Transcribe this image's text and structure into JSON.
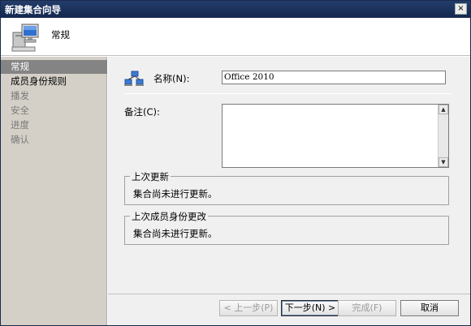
{
  "window": {
    "title": "新建集合向导",
    "close_glyph": "×"
  },
  "header": {
    "title": "常规",
    "icon": "computer-icon"
  },
  "nav": {
    "items": [
      {
        "label": "常规",
        "state": "active"
      },
      {
        "label": "成员身份规则",
        "state": "enabled"
      },
      {
        "label": "播发",
        "state": "disabled"
      },
      {
        "label": "安全",
        "state": "disabled"
      },
      {
        "label": "进度",
        "state": "disabled"
      },
      {
        "label": "确认",
        "state": "disabled"
      }
    ]
  },
  "form": {
    "name_label": "名称(N):",
    "name_value": "Office 2010",
    "notes_label": "备注(C):",
    "notes_value": "",
    "scroll_up": "▲",
    "scroll_down": "▼"
  },
  "groups": {
    "last_update": {
      "title": "上次更新",
      "text": "集合尚未进行更新。"
    },
    "last_membership": {
      "title": "上次成员身份更改",
      "text": "集合尚未进行更新。"
    }
  },
  "buttons": {
    "prev": "< 上一步(P)",
    "next": "下一步(N) >",
    "finish": "完成(F)",
    "cancel": "取消"
  },
  "colors": {
    "titlebar": "#1c3561",
    "nav_bg": "#d4d0c8",
    "nav_active": "#848484",
    "content_bg": "#f0f0f0"
  }
}
